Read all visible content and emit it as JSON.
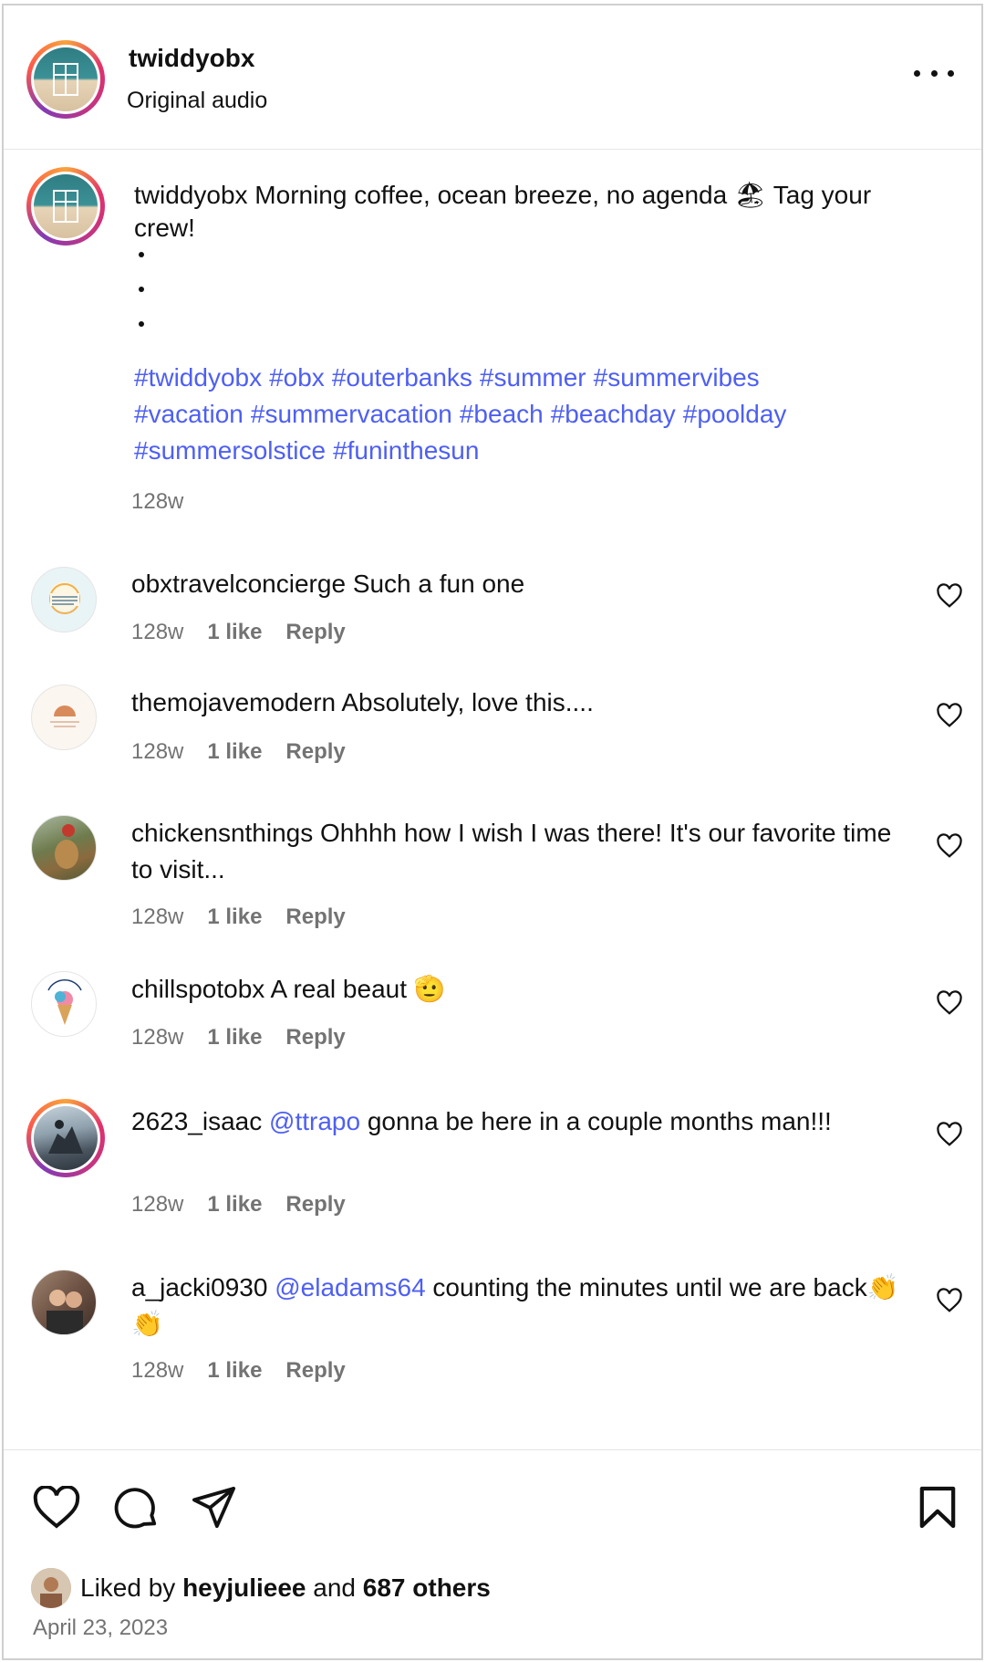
{
  "header": {
    "username": "twiddyobx",
    "subtitle": "Original audio",
    "more_icon": "more-horizontal-icon"
  },
  "caption": {
    "username": "twiddyobx",
    "text": "Morning coffee, ocean breeze, no agenda 🏖 Tag your crew!",
    "hashtags": [
      "#twiddyobx",
      "#obx",
      "#outerbanks",
      "#summer",
      "#summervibes",
      "#vacation",
      "#summervacation",
      "#beach",
      "#beachday",
      "#poolday",
      "#summersolstice",
      "#funinthesun"
    ],
    "time": "128w"
  },
  "comments": [
    {
      "username": "obxtravelconcierge",
      "mention": "",
      "text": "Such a fun one",
      "time": "128w",
      "likes": "1 like",
      "reply": "Reply"
    },
    {
      "username": "themojavemodern",
      "mention": "",
      "text": "Absolutely, love this....",
      "time": "128w",
      "likes": "1 like",
      "reply": "Reply"
    },
    {
      "username": "chickensnthings",
      "mention": "",
      "text": "Ohhhh how I wish I was there! It's our favorite time to visit...",
      "time": "128w",
      "likes": "1 like",
      "reply": "Reply"
    },
    {
      "username": "chillspotobx",
      "mention": "",
      "text": "A real beaut 🫡",
      "time": "128w",
      "likes": "1 like",
      "reply": "Reply"
    },
    {
      "username": "2623_isaac",
      "mention": "@ttrapo",
      "text": "gonna be here in a couple months man!!!",
      "time": "128w",
      "likes": "1 like",
      "reply": "Reply"
    },
    {
      "username": "a_jacki0930",
      "mention": "@eladams64",
      "text": "counting the minutes until we are back👏👏",
      "time": "128w",
      "likes": "1 like",
      "reply": "Reply"
    }
  ],
  "footer": {
    "liked_prefix": "Liked by",
    "liked_user": "heyjulieee",
    "liked_and": "and",
    "liked_others": "687 others",
    "date": "April 23, 2023"
  },
  "colors": {
    "link": "#4e5ff3",
    "muted": "#737373",
    "text": "#111111"
  }
}
